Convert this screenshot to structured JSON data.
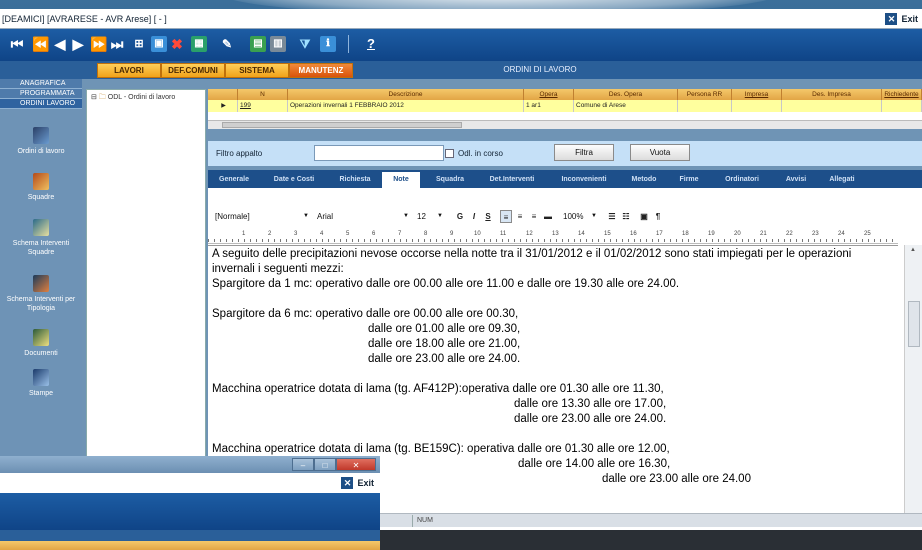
{
  "window": {
    "title": "[DEAMICI] [AVRARESE - AVR Arese] [ - ]",
    "exit_label": "Exit"
  },
  "toolbar": {
    "buttons": [
      "first-record",
      "prev-page",
      "prev-record",
      "next-record",
      "next-page",
      "last-record",
      "new-record",
      "save",
      "delete",
      "calc",
      "tools",
      "print-preview",
      "export",
      "filter",
      "info"
    ],
    "help_label": "?"
  },
  "menu": {
    "items": [
      "LAVORI",
      "DEF.COMUNI",
      "SISTEMA",
      "MANUTENZ"
    ],
    "active": "MANUTENZ",
    "section_title": "ORDINI DI LAVORO"
  },
  "sidebar": {
    "tabs": [
      "ANAGRAFICA",
      "PROGRAMMATA",
      "ORDINI LAVORO"
    ],
    "active_tab": "ORDINI LAVORO",
    "items": [
      {
        "label": "Ordini di lavoro",
        "icon": "work-orders-icon"
      },
      {
        "label": "Squadre",
        "icon": "teams-icon"
      },
      {
        "label": "Schema Interventi Squadre",
        "icon": "team-schema-icon"
      },
      {
        "label": "Schema Interventi per Tipologia",
        "icon": "type-schema-icon"
      },
      {
        "label": "Documenti",
        "icon": "documents-icon"
      },
      {
        "label": "Stampe",
        "icon": "print-icon"
      }
    ]
  },
  "tree": {
    "root_label": "ODL - Ordini di lavoro"
  },
  "grid": {
    "columns": [
      "",
      "N",
      "Descrizione",
      "Opera",
      "Des. Opera",
      "Persona RR",
      "Impresa",
      "Des. Impresa",
      "Richiedente"
    ],
    "rows": [
      {
        "n": "199",
        "descrizione": "Operazioni invernali 1 FEBBRAIO 2012",
        "opera": "1 ar1",
        "des_opera": "Comune di Arese",
        "persona": "",
        "impresa": "",
        "des_impresa": "",
        "richiedente": ""
      }
    ]
  },
  "filter": {
    "label": "Filtro appalto",
    "value": "",
    "checkbox_label": "Odl. in corso",
    "filter_button": "Filtra",
    "clear_button": "Vuota"
  },
  "tabs": {
    "items": [
      "Generale",
      "Date e Costi",
      "Richiesta",
      "Note",
      "Squadra",
      "Det.Interventi",
      "Inconvenienti",
      "Metodo",
      "Firme",
      "Ordinatori",
      "Avvisi",
      "Allegati"
    ],
    "active": "Note"
  },
  "editor": {
    "style": "[Normale]",
    "font": "Arial",
    "size": "12",
    "zoom": "100%",
    "ruler_numbers": [
      "1",
      "2",
      "3",
      "4",
      "5",
      "6",
      "7",
      "8",
      "9",
      "10",
      "11",
      "12",
      "13",
      "14",
      "15",
      "16",
      "17",
      "18",
      "19",
      "20",
      "21",
      "22",
      "23",
      "24",
      "25"
    ],
    "lines": [
      "A seguito delle precipitazioni nevose occorse nella notte tra il 31/01/2012 e il 01/02/2012 sono stati impiegati per le operazioni",
      "invernali i seguenti mezzi:",
      "Spargitore da 1 mc: operativo dalle ore 00.00 alle ore 11.00 e dalle ore 19.30 alle ore 24.00.",
      "Spargitore da 6 mc: operativo dalle ore 00.00 alle ore 00.30,",
      "dalle ore 01.00 alle ore 09.30,",
      "dalle ore 18.00 alle ore 21.00,",
      "dalle ore 23.00 alle ore 24.00.",
      "Macchina operatrice dotata di lama (tg. AF412P):operativa dalle ore 01.30 alle ore 11.30,",
      "dalle ore 13.30 alle ore 17.00,",
      "dalle ore 23.00 alle ore 24.00.",
      "Macchina operatrice dotata di lama (tg. BE159C): operativa dalle ore 01.30 alle ore 12.00,",
      "dalle ore 14.00 alle ore 16.30,",
      "dalle ore 23.00 alle ore 24.00"
    ]
  },
  "status": {
    "num": "NUM"
  },
  "second_window": {
    "exit_label": "Exit"
  },
  "colors": {
    "accent": "#1d4f8a",
    "menu_orange": "#f0a21a",
    "row_highlight": "#ffff9e"
  }
}
